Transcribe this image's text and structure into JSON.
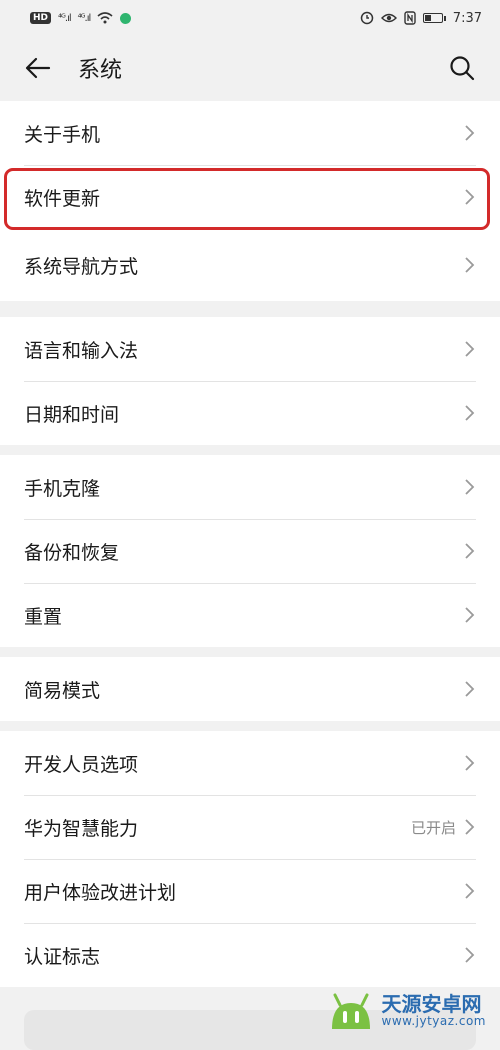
{
  "status_bar": {
    "hd_badge": "HD",
    "signal1": "⁴ᴳ.ıl",
    "signal2": "⁴ᴳ.ıl",
    "time": "7:37"
  },
  "header": {
    "title": "系统"
  },
  "groups": [
    {
      "items": [
        {
          "label": "关于手机"
        },
        {
          "label": "软件更新"
        },
        {
          "label": "系统导航方式"
        }
      ]
    },
    {
      "items": [
        {
          "label": "语言和输入法"
        },
        {
          "label": "日期和时间"
        }
      ]
    },
    {
      "items": [
        {
          "label": "手机克隆"
        },
        {
          "label": "备份和恢复"
        },
        {
          "label": "重置"
        }
      ]
    },
    {
      "items": [
        {
          "label": "简易模式"
        }
      ]
    },
    {
      "items": [
        {
          "label": "开发人员选项"
        },
        {
          "label": "华为智慧能力",
          "value": "已开启"
        },
        {
          "label": "用户体验改进计划"
        },
        {
          "label": "认证标志"
        }
      ]
    }
  ],
  "highlight_color": "#d32a2a",
  "watermark": {
    "name": "天源安卓网",
    "url": "www.jytyaz.com"
  }
}
